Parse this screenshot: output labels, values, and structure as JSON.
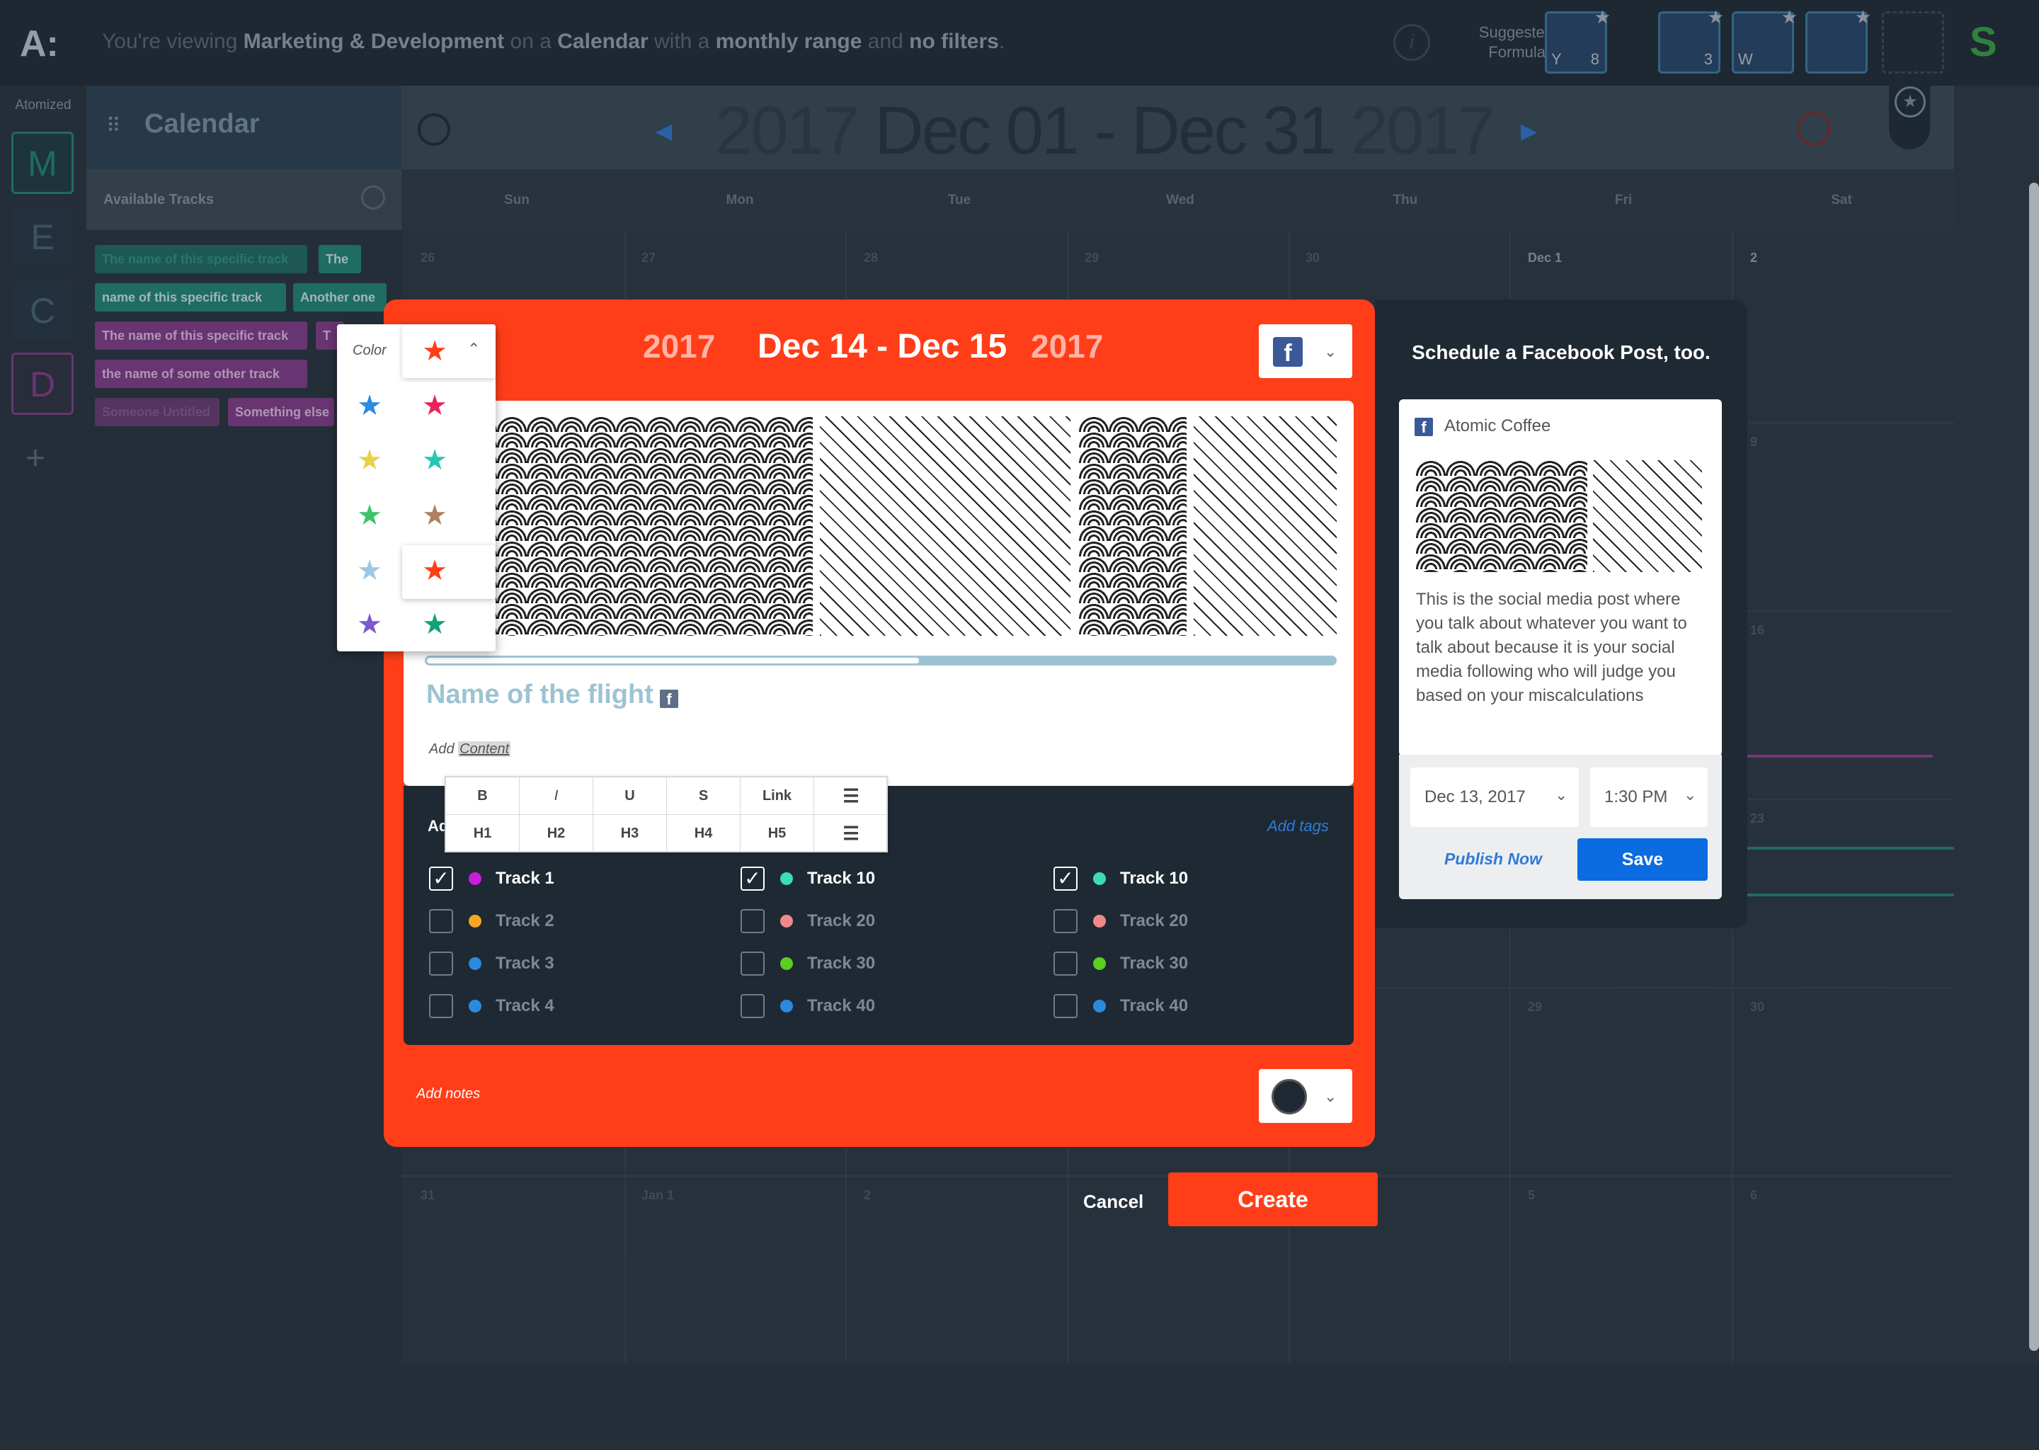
{
  "topbar": {
    "logo": "A:",
    "viewing_prefix": "You're viewing",
    "viewing_team": "Marketing & Development",
    "viewing_on": "on a",
    "viewing_view": "Calendar",
    "viewing_with": "with a",
    "viewing_range": "monthly range",
    "viewing_and": "and",
    "viewing_filters": "no filters",
    "viewing_end": ".",
    "info_icon": "i",
    "suggested_formulas": "Suggested Formulas",
    "formulas": [
      {
        "label": "Y",
        "number": "8"
      },
      {
        "label": "",
        "number": "3"
      },
      {
        "label": "W",
        "number": ""
      },
      {
        "label": "",
        "number": ""
      }
    ],
    "brand_icon": "S"
  },
  "rail": {
    "title": "Atomized",
    "tiles": [
      {
        "letter": "M",
        "color": "#1f8a78"
      },
      {
        "letter": "E",
        "color": "#1f5a6b"
      },
      {
        "letter": "C",
        "color": "#1f5a6b"
      },
      {
        "letter": "D",
        "color": "#8a3a8f"
      }
    ],
    "add": "+"
  },
  "sidebar": {
    "title": "Calendar",
    "available_tracks": "Available Tracks",
    "chips": [
      {
        "text": "The name of this specific track",
        "color": "#1f8a78",
        "fg": "#2d9a86"
      },
      {
        "text": "The",
        "color": "#1f8a78",
        "fg": "#d8f3ee"
      },
      {
        "text": "name of this specific track",
        "color": "#1f8a78",
        "fg": "#d8f3ee"
      },
      {
        "text": "Another one",
        "color": "#1f8a78",
        "fg": "#d8f3ee"
      },
      {
        "text": "The name of this specific track",
        "color": "#8a3a8f",
        "fg": "#e9c8ea"
      },
      {
        "text": "T",
        "color": "#8a3a8f",
        "fg": "#e9c8ea"
      },
      {
        "text": "the name of some other track",
        "color": "#8a3a8f",
        "fg": "#e9c8ea"
      },
      {
        "text": "Someone Untitled",
        "color": "#6d3a73",
        "fg": "#8f5a94"
      },
      {
        "text": "Something else",
        "color": "#8a3a8f",
        "fg": "#e9c8ea"
      }
    ]
  },
  "calendar": {
    "year_left": "2017",
    "range": "Dec 01 - Dec 31",
    "year_right": "2017",
    "prev": "◀",
    "next": "▶",
    "days": [
      "Sun",
      "Mon",
      "Tue",
      "Wed",
      "Thu",
      "Fri",
      "Sat"
    ],
    "row1": [
      "26",
      "27",
      "28",
      "29",
      "30",
      "Dec 1",
      "2"
    ],
    "side_nums": [
      "9",
      "16",
      "23",
      "30"
    ],
    "last_row_left": [
      "31",
      "Jan 1",
      "2"
    ],
    "last_row_right": [
      "5",
      "6"
    ],
    "row5_right": [
      "29"
    ]
  },
  "color_picker": {
    "label": "Color",
    "current": "#ff3e19",
    "options_left": [
      "#2a8ae0",
      "#e8d04a",
      "#3cc46a",
      "#9ec8e4",
      "#7b5ad0"
    ],
    "options_right": [
      "#e8245a",
      "#26c8b4",
      "#b08060",
      "#ff3e19",
      "#14a07a"
    ],
    "star": "★"
  },
  "modal": {
    "year_left": "2017",
    "dates": "Dec 14 - Dec 15",
    "year_right": "2017",
    "fb_letter": "f",
    "progress": 0.53,
    "flight_name": "Name of the flight",
    "add_content_prefix": "Add",
    "add_content_word": "Content",
    "toolbar_row1": [
      "B",
      "I",
      "U",
      "S",
      "Link",
      "list-bullets-icon"
    ],
    "toolbar_row2": [
      "H1",
      "H2",
      "H3",
      "H4",
      "H5",
      "list-lines-icon"
    ],
    "add_label": "Ad",
    "add_tags": "Add tags",
    "columns": [
      [
        {
          "label": "Track 1",
          "checked": true,
          "color": "#c81edb"
        },
        {
          "label": "Track 2",
          "checked": false,
          "color": "#f5a623"
        },
        {
          "label": "Track 3",
          "checked": false,
          "color": "#2a8ae0"
        },
        {
          "label": "Track 4",
          "checked": false,
          "color": "#2a8ae0"
        }
      ],
      [
        {
          "label": "Track 10",
          "checked": true,
          "color": "#3ddcb4"
        },
        {
          "label": "Track 20",
          "checked": false,
          "color": "#f08a8a"
        },
        {
          "label": "Track 30",
          "checked": false,
          "color": "#5ad01e"
        },
        {
          "label": "Track 40",
          "checked": false,
          "color": "#2a8ae0"
        }
      ],
      [
        {
          "label": "Track 10",
          "checked": true,
          "color": "#3ddcb4"
        },
        {
          "label": "Track 20",
          "checked": false,
          "color": "#f08a8a"
        },
        {
          "label": "Track 30",
          "checked": false,
          "color": "#5ad01e"
        },
        {
          "label": "Track 40",
          "checked": false,
          "color": "#2a8ae0"
        }
      ]
    ],
    "add_notes": "Add notes",
    "cancel": "Cancel",
    "create": "Create"
  },
  "facebook": {
    "title": "Schedule a Facebook Post, too.",
    "page_name": "Atomic Coffee",
    "post_text": "This is the social media post where you talk about whatever you want to talk about because it is your social media following who will judge you based on your miscalculations",
    "date": "Dec 13, 2017",
    "time": "1:30 PM",
    "publish_now": "Publish Now",
    "save": "Save"
  }
}
